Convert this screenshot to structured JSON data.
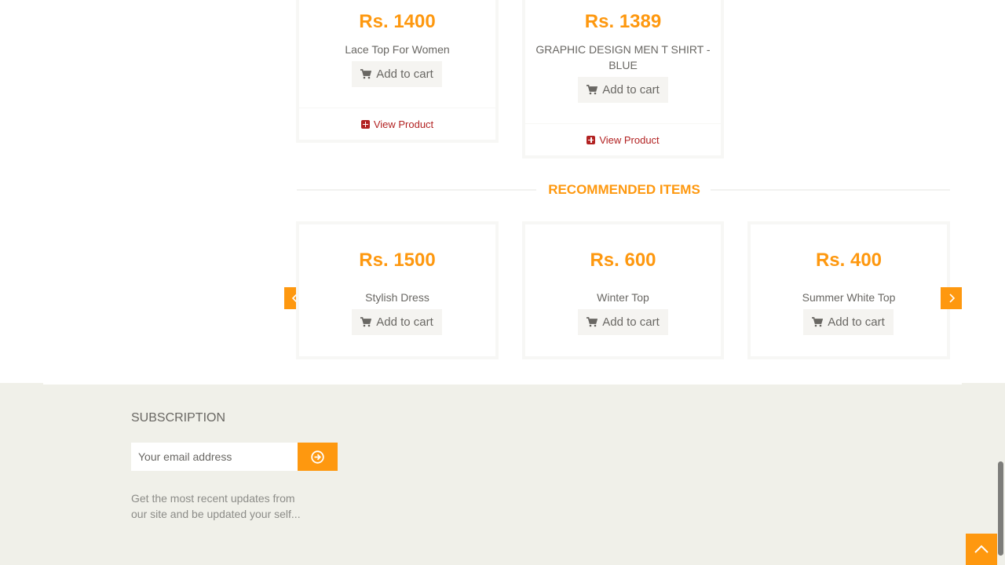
{
  "top_products": [
    {
      "price": "Rs. 1400",
      "name": "Lace Top For Women",
      "cart_label": "Add to cart",
      "view_label": "View Product"
    },
    {
      "price": "Rs. 1389",
      "name": "GRAPHIC DESIGN MEN T SHIRT - BLUE",
      "cart_label": "Add to cart",
      "view_label": "View Product"
    }
  ],
  "recommended": {
    "title": "RECOMMENDED ITEMS",
    "items": [
      {
        "price": "Rs. 1500",
        "name": "Stylish Dress",
        "cart_label": "Add to cart"
      },
      {
        "price": "Rs. 600",
        "name": "Winter Top",
        "cart_label": "Add to cart"
      },
      {
        "price": "Rs. 400",
        "name": "Summer White Top",
        "cart_label": "Add to cart"
      }
    ]
  },
  "footer": {
    "subscription_title": "SUBSCRIPTION",
    "email_placeholder": "Your email address",
    "note": "Get the most recent updates from our site and be updated your self..."
  },
  "colors": {
    "accent": "#fe980f",
    "view_link": "#b22222",
    "footer_bg": "#f0f0e9"
  },
  "icons": [
    "cart-icon",
    "plus-square-icon",
    "chevron-left-icon",
    "chevron-right-icon",
    "arrow-circle-right-icon",
    "chevron-up-icon"
  ]
}
